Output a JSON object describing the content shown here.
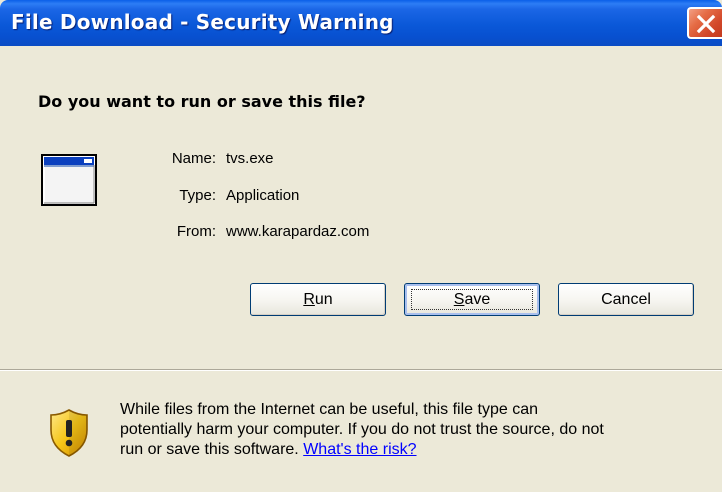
{
  "window": {
    "title": "File Download - Security Warning"
  },
  "dialog": {
    "question": "Do you want to run or save this file?",
    "file_info": [
      {
        "label": "Name:",
        "value": "tvs.exe"
      },
      {
        "label": "Type:",
        "value": "Application"
      },
      {
        "label": "From:",
        "value": "www.karapardaz.com"
      }
    ],
    "icons": {
      "file": "application-window-icon",
      "warning": "security-shield-icon",
      "close": "close-icon"
    }
  },
  "buttons": {
    "run": {
      "accel": "R",
      "rest": "un"
    },
    "save": {
      "accel": "S",
      "rest": "ave"
    },
    "cancel": "Cancel"
  },
  "warning": {
    "line1": "While files from the Internet can be useful, this file type can",
    "line2": "potentially harm your computer. If you do not trust the source, do not",
    "line3": "run or save this software.",
    "link": "What's the risk?"
  },
  "colors": {
    "titlebar": "#0a58d8",
    "dialog_bg": "#ece9d8",
    "close_button": "#d2482a",
    "link": "#0000ff",
    "shield_yellow": "#f5c518"
  }
}
